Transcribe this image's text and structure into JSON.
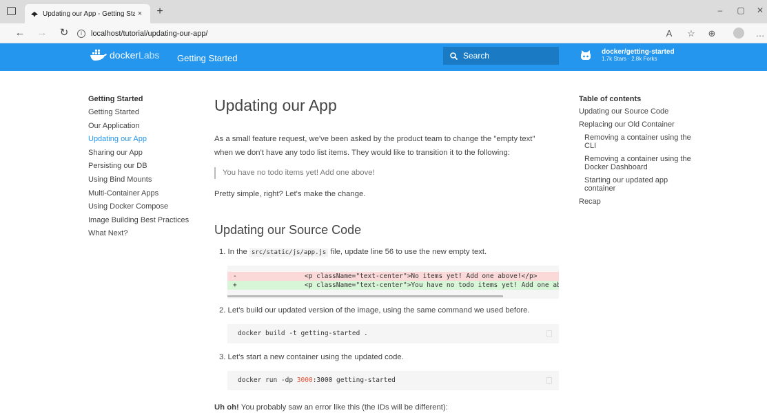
{
  "browser": {
    "tab_title": "Updating our App - Getting Star",
    "tab_close": "×",
    "new_tab": "+",
    "url": "localhost/tutorial/updating-our-app/",
    "window": {
      "minimize": "–",
      "maximize": "▢",
      "close": "✕"
    }
  },
  "header": {
    "logo_main": "docker",
    "logo_labs": "Labs",
    "nav_title": "Getting Started",
    "search_placeholder": "Search",
    "repo_name": "docker/getting-started",
    "repo_stats": "1.7k Stars · 2.8k Forks",
    "color": "#2496ed"
  },
  "leftnav": {
    "heading": "Getting Started",
    "items": [
      {
        "label": "Getting Started"
      },
      {
        "label": "Our Application"
      },
      {
        "label": "Updating our App"
      },
      {
        "label": "Sharing our App"
      },
      {
        "label": "Persisting our DB"
      },
      {
        "label": "Using Bind Mounts"
      },
      {
        "label": "Multi-Container Apps"
      },
      {
        "label": "Using Docker Compose"
      },
      {
        "label": "Image Building Best Practices"
      },
      {
        "label": "What Next?"
      }
    ],
    "active_index": 2
  },
  "main": {
    "title": "Updating our App",
    "intro_line1": "As a small feature request, we've been asked by the product team to change the \"empty text\"",
    "intro_line2": "when we don't have any todo list items. They would like to transition it to the following:",
    "quote": "You have no todo items yet! Add one above!",
    "simple": "Pretty simple, right? Let's make the change.",
    "section_title": "Updating our Source Code",
    "step1_pre": "1. In the",
    "step1_code": "src/static/js/app.js",
    "step1_post": "file, update line 56 to use the new empty text.",
    "diff_del_sign": "-",
    "diff_del": "<p className=\"text-center\">No items yet! Add one above!</p>",
    "diff_add_sign": "+",
    "diff_add": "<p className=\"text-center\">You have no todo items yet! Add one above!</p>",
    "step2": "2. Let's build our updated version of the image, using the same command we used before.",
    "cmd_build": "docker build -t getting-started .",
    "step3": "3. Let's start a new container using the updated code.",
    "cmd_run_pre": "docker run -dp ",
    "cmd_run_port": "3000",
    "cmd_run_post": ":3000 getting-started",
    "uhoh_bold": "Uh oh!",
    "uhoh_rest": " You probably saw an error like this (the IDs will be different):"
  },
  "toc": {
    "heading": "Table of contents",
    "items": [
      {
        "label": "Updating our Source Code"
      },
      {
        "label": "Replacing our Old Container"
      },
      {
        "label": "Removing a container using the CLI"
      },
      {
        "label": "Removing a container using the Docker Dashboard"
      },
      {
        "label": "Starting our updated app container"
      },
      {
        "label": "Recap"
      }
    ]
  }
}
